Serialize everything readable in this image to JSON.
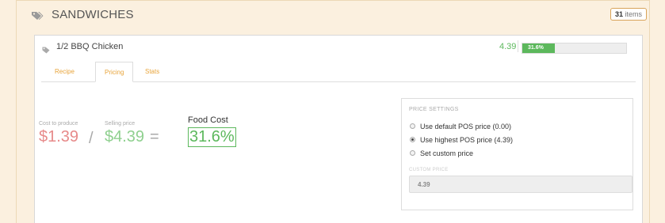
{
  "section": {
    "title": "SANDWICHES",
    "items_count": "31",
    "items_suffix": "items",
    "icon": "tags-icon"
  },
  "item": {
    "name": "1/2 BBQ Chicken",
    "icon": "tag-icon",
    "food_cost_value": "4.39",
    "food_cost_percent_label": "31.6%",
    "food_cost_fraction": 0.316
  },
  "tabs": [
    {
      "label": "Recipe",
      "active": false
    },
    {
      "label": "Pricing",
      "active": true
    },
    {
      "label": "Stats",
      "active": false
    }
  ],
  "pricing": {
    "cost_label": "Cost to produce",
    "cost_value": "$1.39",
    "divide_symbol": "/",
    "selling_label": "Selling price",
    "selling_value": "$4.39",
    "equals_symbol": "=",
    "food_cost_label": "Food Cost",
    "food_cost_value": "31.6%"
  },
  "price_settings": {
    "title": "PRICE SETTINGS",
    "options": [
      {
        "label": "Use default POS price (0.00)",
        "checked": false
      },
      {
        "label": "Use highest POS price (4.39)",
        "checked": true
      },
      {
        "label": "Set custom price",
        "checked": false
      }
    ],
    "custom_label": "CUSTOM PRICE",
    "custom_value": "4.39"
  },
  "colors": {
    "accent": "#e8a43a",
    "cost": "#e78a8a",
    "selling": "#8fd08f",
    "good": "#5cb85c",
    "background": "#fbf0df"
  }
}
